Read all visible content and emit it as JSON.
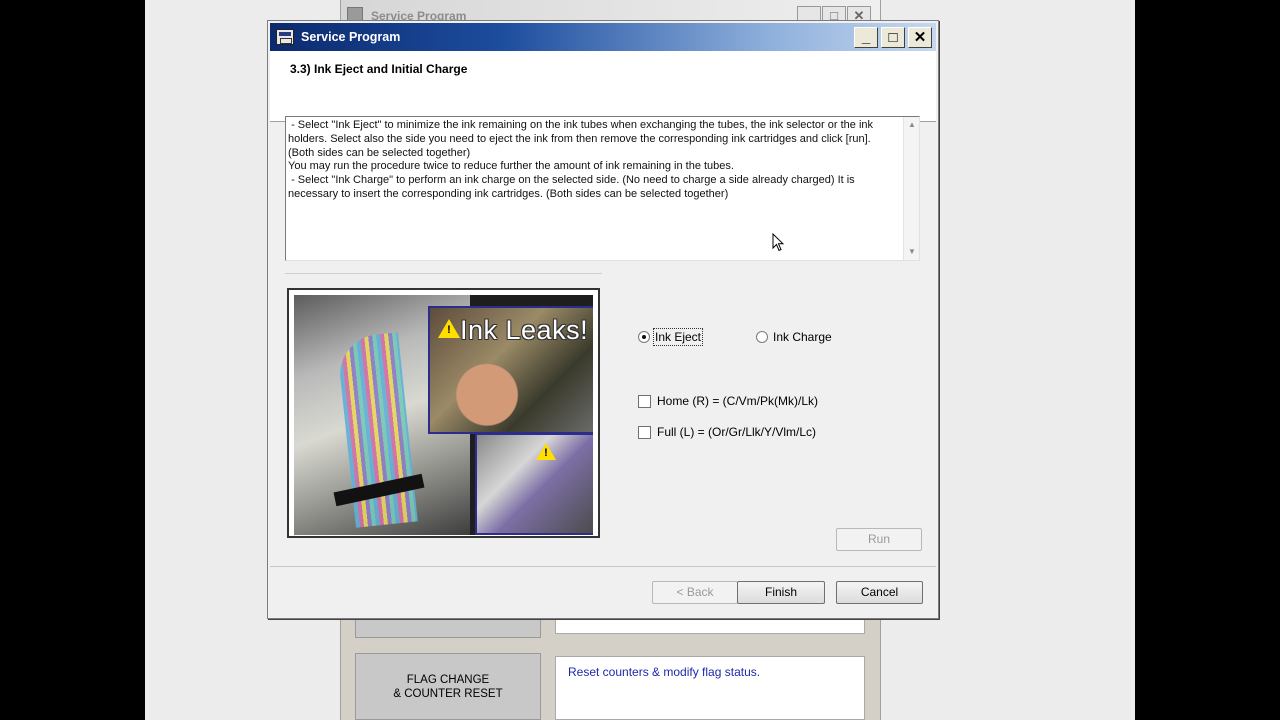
{
  "background_window": {
    "title": "Service Program",
    "flag_button": "FLAG CHANGE\n& COUNTER RESET",
    "flag_desc": "Reset counters & modify flag status."
  },
  "dialog": {
    "title": "Service Program",
    "step_title": "3.3) Ink Eject and Initial Charge",
    "description": " - Select \"Ink Eject\" to minimize the ink remaining on the ink tubes when exchanging the tubes, the ink selector or the ink holders. Select also the side you need to eject the ink from then remove the corresponding ink cartridges and click [run]. (Both sides can be selected together)\nYou may run the procedure twice to reduce further the amount of ink remaining in the tubes.\n - Select \"Ink Charge\" to perform an ink charge on the selected side. (No need to charge a side already charged) It is necessary to insert the corresponding ink cartridges. (Both sides can be selected together)",
    "image_overlay_text": "Ink Leaks!",
    "options": {
      "ink_eject": {
        "label": "Ink Eject",
        "selected": true
      },
      "ink_charge": {
        "label": "Ink Charge",
        "selected": false
      }
    },
    "checkboxes": {
      "home": {
        "label": "Home (R) = (C/Vm/Pk(Mk)/Lk)",
        "checked": false
      },
      "full": {
        "label": "Full (L) = (Or/Gr/Llk/Y/Vlm/Lc)",
        "checked": false
      }
    },
    "buttons": {
      "run": "Run",
      "back": "< Back",
      "finish": "Finish",
      "cancel": "Cancel"
    },
    "window_controls": {
      "minimize": "_",
      "maximize": "□",
      "close": "✕"
    }
  },
  "colors": {
    "titlebar_dark": "#0b2a6e",
    "titlebar_light": "#c6d8ef",
    "link_blue": "#1d2aa8",
    "warning_yellow": "#ffde00"
  }
}
